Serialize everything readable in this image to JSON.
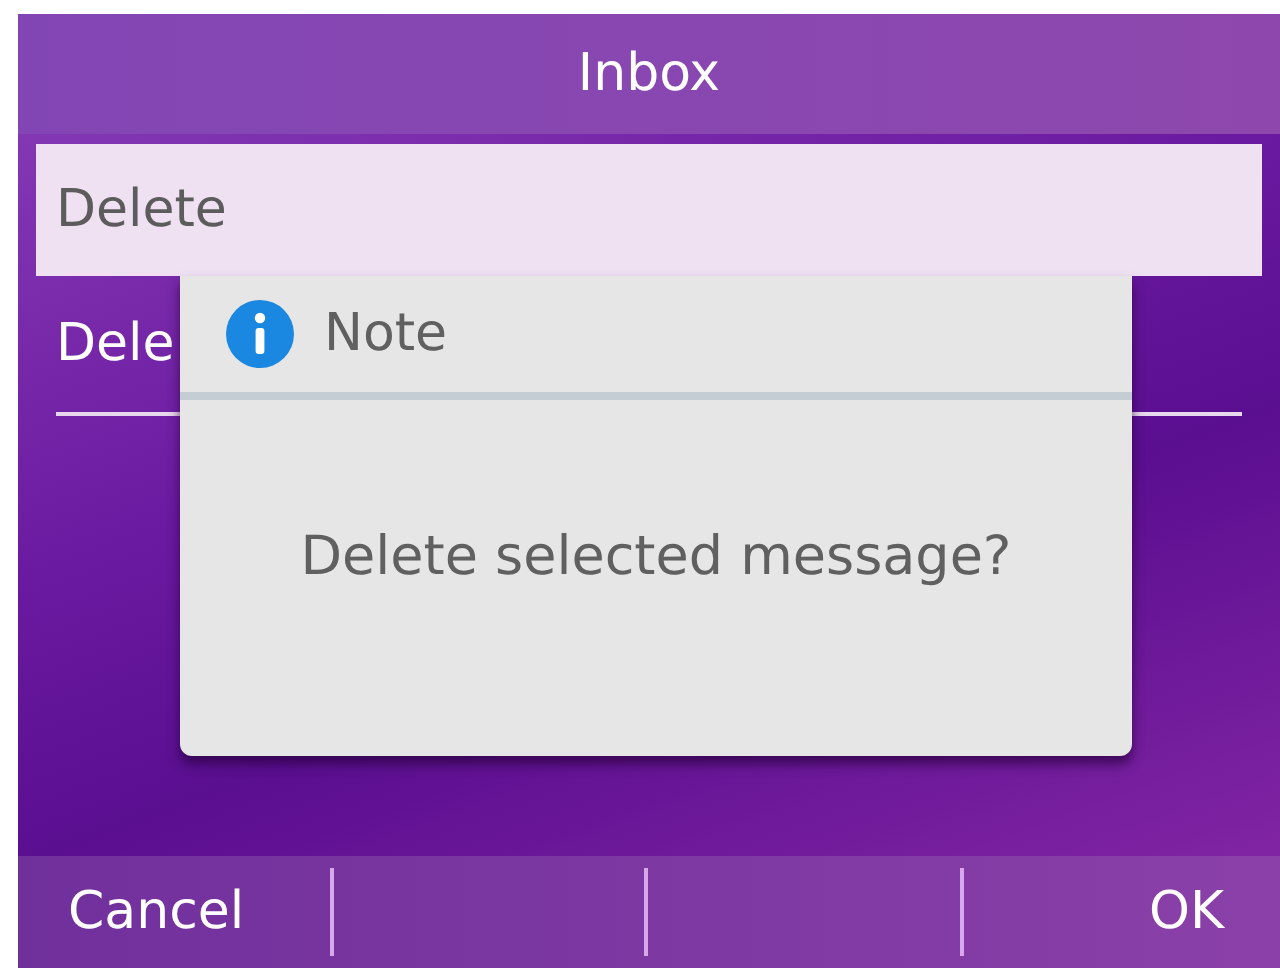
{
  "title": "Inbox",
  "menu": [
    {
      "label": "Delete",
      "selected": true
    },
    {
      "label": "Dele",
      "selected": false
    }
  ],
  "dialog": {
    "title": "Note",
    "message": "Delete selected message?"
  },
  "softkeys": {
    "left": "Cancel",
    "right": "OK"
  }
}
